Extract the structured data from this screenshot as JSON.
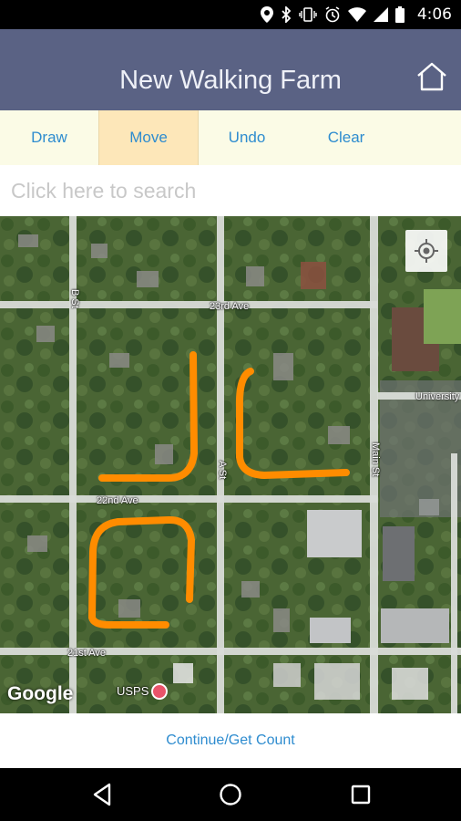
{
  "status_bar": {
    "time": "4:06"
  },
  "app_bar": {
    "title": "New Walking Farm",
    "home_icon": "home-icon"
  },
  "toolbar": {
    "draw": "Draw",
    "move": "Move",
    "undo": "Undo",
    "clear": "Clear",
    "active": "Move"
  },
  "search": {
    "placeholder": "Click here to search",
    "value": ""
  },
  "map": {
    "streets": [
      "23rd Ave",
      "22nd Ave",
      "21st Ave",
      "B St",
      "A St",
      "Main St",
      "University"
    ],
    "poi": "USPS",
    "attribution": "Google",
    "route_color": "#ff8c00"
  },
  "footer": {
    "continue_label": "Continue/Get Count"
  },
  "nav": {
    "back": "back-icon",
    "home": "home-circle-icon",
    "recents": "recents-icon"
  }
}
